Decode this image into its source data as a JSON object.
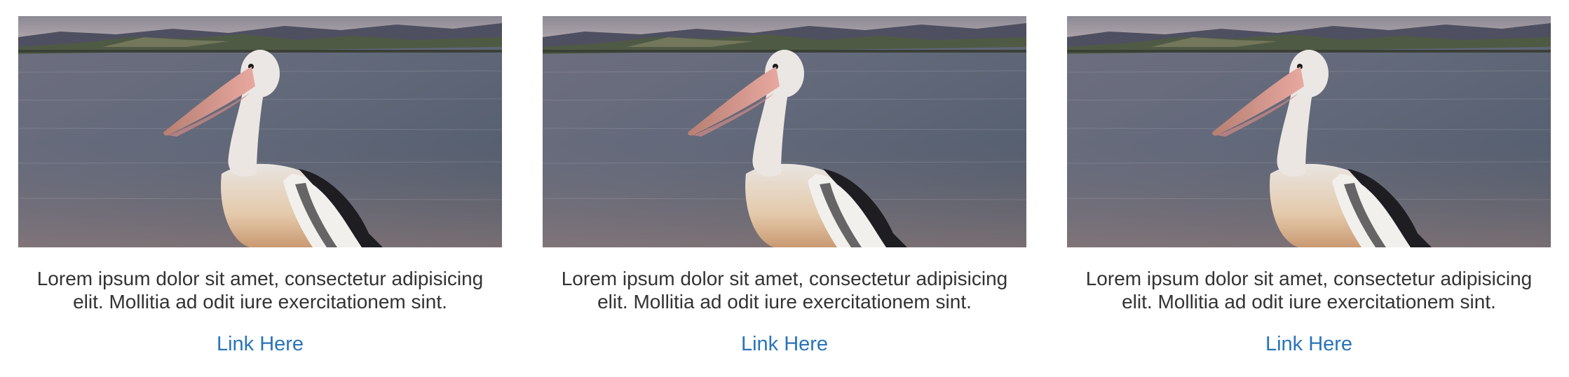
{
  "cards": [
    {
      "image_alt": "Pelican standing by a lake at dusk",
      "description": "Lorem ipsum dolor sit amet, consectetur adipisicing elit. Mollitia ad odit iure exercitationem sint.",
      "link_label": "Link Here"
    },
    {
      "image_alt": "Pelican standing by a lake at dusk",
      "description": "Lorem ipsum dolor sit amet, consectetur adipisicing elit. Mollitia ad odit iure exercitationem sint.",
      "link_label": "Link Here"
    },
    {
      "image_alt": "Pelican standing by a lake at dusk",
      "description": "Lorem ipsum dolor sit amet, consectetur adipisicing elit. Mollitia ad odit iure exercitationem sint.",
      "link_label": "Link Here"
    }
  ],
  "colors": {
    "link": "#2a74b8",
    "text": "#333333"
  }
}
